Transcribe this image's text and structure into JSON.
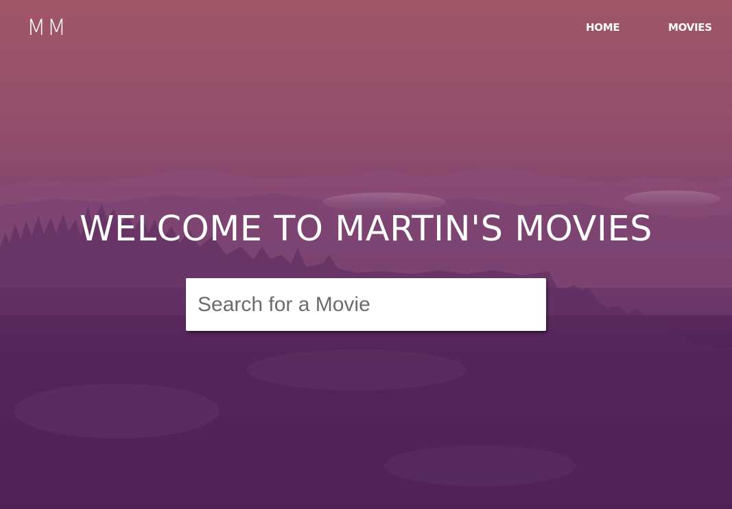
{
  "brand": {
    "logo_text": "MM"
  },
  "nav": {
    "items": [
      {
        "label": "HOME"
      },
      {
        "label": "MOVIES"
      }
    ]
  },
  "hero": {
    "title": "WELCOME TO MARTIN'S MOVIES",
    "background_image": "misty-purple-mountains-forest",
    "overlay_colors": [
      "#a05667",
      "#43184f"
    ]
  },
  "search": {
    "placeholder": "Search for a Movie",
    "value": ""
  }
}
